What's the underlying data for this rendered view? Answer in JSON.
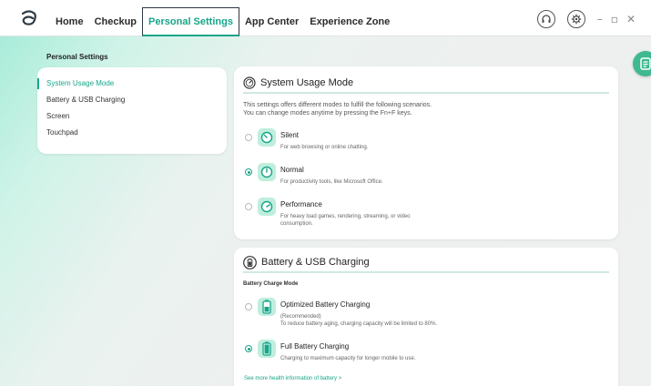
{
  "nav": {
    "items": [
      "Home",
      "Checkup",
      "Personal Settings",
      "App Center",
      "Experience Zone"
    ],
    "active": "Personal Settings"
  },
  "window_controls": {
    "minimize": "–",
    "restore": "▫",
    "close": "✕"
  },
  "page": {
    "heading": "Personal Settings"
  },
  "sidebar": {
    "items": [
      {
        "label": "System Usage Mode",
        "active": true
      },
      {
        "label": "Battery & USB Charging",
        "active": false
      },
      {
        "label": "Screen",
        "active": false
      },
      {
        "label": "Touchpad",
        "active": false
      }
    ]
  },
  "usage_mode": {
    "title": "System Usage Mode",
    "desc_line1": "This settings offers different modes to fulfill the following scenarios.",
    "desc_line2": "You can change modes anytime by pressing the Fn+F keys.",
    "options": [
      {
        "label": "Silent",
        "sub1": "For web browsing or online chatting.",
        "sub2": "",
        "selected": false,
        "icon": "silent-mode-icon"
      },
      {
        "label": "Normal",
        "sub1": "For productivity tools, like Microsoft Office.",
        "sub2": "",
        "selected": true,
        "icon": "normal-mode-icon"
      },
      {
        "label": "Performance",
        "sub1": "For heavy load games, rendering, streaming, or video",
        "sub2": "consumption.",
        "selected": false,
        "icon": "performance-mode-icon"
      }
    ]
  },
  "battery": {
    "title": "Battery & USB Charging",
    "mode_heading": "Battery Charge Mode",
    "options": [
      {
        "label": "Optimized Battery Charging",
        "sub1": "(Recommended)",
        "sub2": "To reduce battery aging, charging capacity will be limited to 80%.",
        "selected": false,
        "icon": "battery-half-icon"
      },
      {
        "label": "Full Battery Charging",
        "sub1": "Charging to maximum capacity for longer mobile to use.",
        "sub2": "",
        "selected": true,
        "icon": "battery-full-icon"
      }
    ],
    "more_link": "See more health information of battery >"
  },
  "colors": {
    "accent": "#17a589",
    "icon_bg": "#bfeedd"
  }
}
